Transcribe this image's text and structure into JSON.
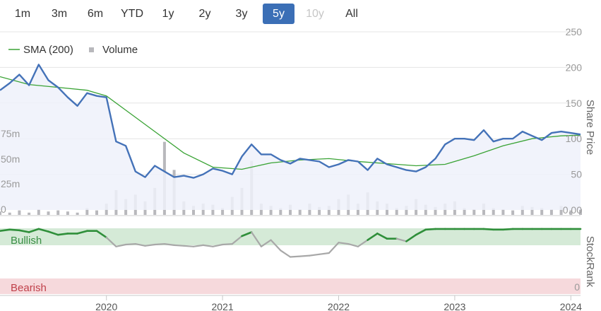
{
  "range_buttons": [
    {
      "label": "1m",
      "active": false,
      "disabled": false
    },
    {
      "label": "3m",
      "active": false,
      "disabled": false
    },
    {
      "label": "6m",
      "active": false,
      "disabled": false
    },
    {
      "label": "YTD",
      "active": false,
      "disabled": false
    },
    {
      "label": "1y",
      "active": false,
      "disabled": false
    },
    {
      "label": "2y",
      "active": false,
      "disabled": false
    },
    {
      "label": "3y",
      "active": false,
      "disabled": false
    },
    {
      "label": "5y",
      "active": true,
      "disabled": false
    },
    {
      "label": "10y",
      "active": false,
      "disabled": true
    },
    {
      "label": "All",
      "active": false,
      "disabled": false
    }
  ],
  "legend": {
    "sma_label": "SMA (200)",
    "volume_label": "Volume"
  },
  "colors": {
    "price": "#4472b8",
    "sma": "#3aa335",
    "volume": "#b8b8bc",
    "price_area": "#eef1fa",
    "active_button": "#3b6fb6",
    "bullish_band": "#d5ead7",
    "bearish_band": "#f6d9dc",
    "stockrank_bull": "#2f8f3a",
    "stockrank_neutral": "#a8a8a8",
    "bearish_text": "#c0404a",
    "bullish_text": "#3a8f45"
  },
  "axes": {
    "share_price_label": "Share Price",
    "stockrank_label": "StockRank",
    "price_ticks": [
      "250",
      "200",
      "150",
      "100",
      "50",
      "0.00"
    ],
    "volume_ticks": [
      "75m",
      "50m",
      "25m",
      "0"
    ],
    "stockrank_zero": "0",
    "x_ticks": [
      "2020",
      "2021",
      "2022",
      "2023",
      "2024"
    ]
  },
  "bands": {
    "bullish": "Bullish",
    "bearish": "Bearish"
  },
  "chart_data": {
    "type": "line",
    "xlim": [
      "2019-02",
      "2024-02"
    ],
    "price_ylim": [
      0,
      250
    ],
    "volume_ylim": [
      0,
      100
    ],
    "stockrank_ylim": [
      0,
      100
    ],
    "price": [
      [
        "2019-02",
        168
      ],
      [
        "2019-03",
        178
      ],
      [
        "2019-04",
        190
      ],
      [
        "2019-05",
        175
      ],
      [
        "2019-06",
        204
      ],
      [
        "2019-07",
        182
      ],
      [
        "2019-08",
        172
      ],
      [
        "2019-09",
        158
      ],
      [
        "2019-10",
        146
      ],
      [
        "2019-11",
        164
      ],
      [
        "2019-12",
        160
      ],
      [
        "2020-01",
        158
      ],
      [
        "2020-02",
        96
      ],
      [
        "2020-03",
        90
      ],
      [
        "2020-04",
        54
      ],
      [
        "2020-05",
        46
      ],
      [
        "2020-06",
        62
      ],
      [
        "2020-07",
        54
      ],
      [
        "2020-08",
        46
      ],
      [
        "2020-09",
        48
      ],
      [
        "2020-10",
        45
      ],
      [
        "2020-11",
        50
      ],
      [
        "2020-12",
        58
      ],
      [
        "2021-01",
        55
      ],
      [
        "2021-02",
        50
      ],
      [
        "2021-03",
        75
      ],
      [
        "2021-04",
        92
      ],
      [
        "2021-05",
        78
      ],
      [
        "2021-06",
        78
      ],
      [
        "2021-07",
        70
      ],
      [
        "2021-08",
        65
      ],
      [
        "2021-09",
        72
      ],
      [
        "2021-10",
        70
      ],
      [
        "2021-11",
        68
      ],
      [
        "2021-12",
        60
      ],
      [
        "2022-01",
        64
      ],
      [
        "2022-02",
        70
      ],
      [
        "2022-03",
        68
      ],
      [
        "2022-04",
        56
      ],
      [
        "2022-05",
        72
      ],
      [
        "2022-06",
        64
      ],
      [
        "2022-07",
        60
      ],
      [
        "2022-08",
        56
      ],
      [
        "2022-09",
        54
      ],
      [
        "2022-10",
        60
      ],
      [
        "2022-11",
        72
      ],
      [
        "2022-12",
        92
      ],
      [
        "2023-01",
        100
      ],
      [
        "2023-02",
        100
      ],
      [
        "2023-03",
        98
      ],
      [
        "2023-04",
        112
      ],
      [
        "2023-05",
        96
      ],
      [
        "2023-06",
        100
      ],
      [
        "2023-07",
        100
      ],
      [
        "2023-08",
        110
      ],
      [
        "2023-09",
        104
      ],
      [
        "2023-10",
        98
      ],
      [
        "2023-11",
        108
      ],
      [
        "2023-12",
        110
      ],
      [
        "2024-01",
        108
      ],
      [
        "2024-02",
        106
      ]
    ],
    "sma": [
      [
        "2019-02",
        187
      ],
      [
        "2019-05",
        176
      ],
      [
        "2019-08",
        172
      ],
      [
        "2019-11",
        168
      ],
      [
        "2020-01",
        160
      ],
      [
        "2020-03",
        140
      ],
      [
        "2020-06",
        110
      ],
      [
        "2020-09",
        80
      ],
      [
        "2020-12",
        60
      ],
      [
        "2021-03",
        57
      ],
      [
        "2021-06",
        66
      ],
      [
        "2021-09",
        70
      ],
      [
        "2021-12",
        72
      ],
      [
        "2022-03",
        68
      ],
      [
        "2022-06",
        65
      ],
      [
        "2022-09",
        62
      ],
      [
        "2022-12",
        64
      ],
      [
        "2023-03",
        76
      ],
      [
        "2023-06",
        90
      ],
      [
        "2023-09",
        100
      ],
      [
        "2023-12",
        104
      ],
      [
        "2024-02",
        105
      ]
    ],
    "stockrank": [
      [
        "2019-02",
        96
      ],
      [
        "2019-03",
        98
      ],
      [
        "2019-04",
        97
      ],
      [
        "2019-05",
        94
      ],
      [
        "2019-06",
        99
      ],
      [
        "2019-07",
        95
      ],
      [
        "2019-08",
        90
      ],
      [
        "2019-09",
        92
      ],
      [
        "2019-10",
        92
      ],
      [
        "2019-11",
        96
      ],
      [
        "2019-12",
        96
      ],
      [
        "2020-01",
        86
      ],
      [
        "2020-02",
        72
      ],
      [
        "2020-03",
        75
      ],
      [
        "2020-04",
        76
      ],
      [
        "2020-05",
        73
      ],
      [
        "2020-06",
        75
      ],
      [
        "2020-07",
        76
      ],
      [
        "2020-08",
        74
      ],
      [
        "2020-09",
        73
      ],
      [
        "2020-10",
        72
      ],
      [
        "2020-11",
        74
      ],
      [
        "2020-12",
        72
      ],
      [
        "2021-01",
        75
      ],
      [
        "2021-02",
        76
      ],
      [
        "2021-03",
        88
      ],
      [
        "2021-04",
        94
      ],
      [
        "2021-05",
        72
      ],
      [
        "2021-06",
        82
      ],
      [
        "2021-07",
        66
      ],
      [
        "2021-08",
        56
      ],
      [
        "2021-09",
        57
      ],
      [
        "2021-10",
        58
      ],
      [
        "2021-11",
        60
      ],
      [
        "2021-12",
        62
      ],
      [
        "2022-01",
        78
      ],
      [
        "2022-02",
        76
      ],
      [
        "2022-03",
        72
      ],
      [
        "2022-04",
        82
      ],
      [
        "2022-05",
        92
      ],
      [
        "2022-06",
        84
      ],
      [
        "2022-07",
        84
      ],
      [
        "2022-08",
        80
      ],
      [
        "2022-09",
        90
      ],
      [
        "2022-10",
        98
      ],
      [
        "2022-11",
        99
      ],
      [
        "2022-12",
        99
      ],
      [
        "2023-01",
        99
      ],
      [
        "2023-02",
        99
      ],
      [
        "2023-03",
        99
      ],
      [
        "2023-04",
        99
      ],
      [
        "2023-05",
        98
      ],
      [
        "2023-06",
        98
      ],
      [
        "2023-07",
        99
      ],
      [
        "2023-08",
        99
      ],
      [
        "2023-09",
        99
      ],
      [
        "2023-10",
        99
      ],
      [
        "2023-11",
        99
      ],
      [
        "2023-12",
        99
      ],
      [
        "2024-01",
        99
      ],
      [
        "2024-02",
        99
      ]
    ],
    "volume": [
      [
        "2019-02",
        3
      ],
      [
        "2019-03",
        2
      ],
      [
        "2019-04",
        4
      ],
      [
        "2019-05",
        2
      ],
      [
        "2019-06",
        5
      ],
      [
        "2019-07",
        3
      ],
      [
        "2019-08",
        4
      ],
      [
        "2019-09",
        3
      ],
      [
        "2019-10",
        2
      ],
      [
        "2019-11",
        6
      ],
      [
        "2019-12",
        4
      ],
      [
        "2020-01",
        10
      ],
      [
        "2020-02",
        22
      ],
      [
        "2020-03",
        14
      ],
      [
        "2020-04",
        18
      ],
      [
        "2020-05",
        12
      ],
      [
        "2020-06",
        24
      ],
      [
        "2020-07",
        65
      ],
      [
        "2020-08",
        40
      ],
      [
        "2020-09",
        12
      ],
      [
        "2020-10",
        8
      ],
      [
        "2020-11",
        10
      ],
      [
        "2020-12",
        9
      ],
      [
        "2021-01",
        6
      ],
      [
        "2021-02",
        16
      ],
      [
        "2021-03",
        24
      ],
      [
        "2021-04",
        48
      ],
      [
        "2021-05",
        10
      ],
      [
        "2021-06",
        8
      ],
      [
        "2021-07",
        6
      ],
      [
        "2021-08",
        9
      ],
      [
        "2021-09",
        5
      ],
      [
        "2021-10",
        10
      ],
      [
        "2021-11",
        7
      ],
      [
        "2021-12",
        8
      ],
      [
        "2022-01",
        14
      ],
      [
        "2022-02",
        18
      ],
      [
        "2022-03",
        10
      ],
      [
        "2022-04",
        20
      ],
      [
        "2022-05",
        12
      ],
      [
        "2022-06",
        10
      ],
      [
        "2022-07",
        6
      ],
      [
        "2022-08",
        8
      ],
      [
        "2022-09",
        14
      ],
      [
        "2022-10",
        9
      ],
      [
        "2022-11",
        7
      ],
      [
        "2022-12",
        10
      ],
      [
        "2023-01",
        12
      ],
      [
        "2023-02",
        6
      ],
      [
        "2023-03",
        5
      ],
      [
        "2023-04",
        10
      ],
      [
        "2023-05",
        6
      ],
      [
        "2023-06",
        5
      ],
      [
        "2023-07",
        4
      ],
      [
        "2023-08",
        8
      ],
      [
        "2023-09",
        7
      ],
      [
        "2023-10",
        6
      ],
      [
        "2023-11",
        5
      ],
      [
        "2023-12",
        8
      ],
      [
        "2024-01",
        4
      ],
      [
        "2024-02",
        5
      ]
    ]
  }
}
